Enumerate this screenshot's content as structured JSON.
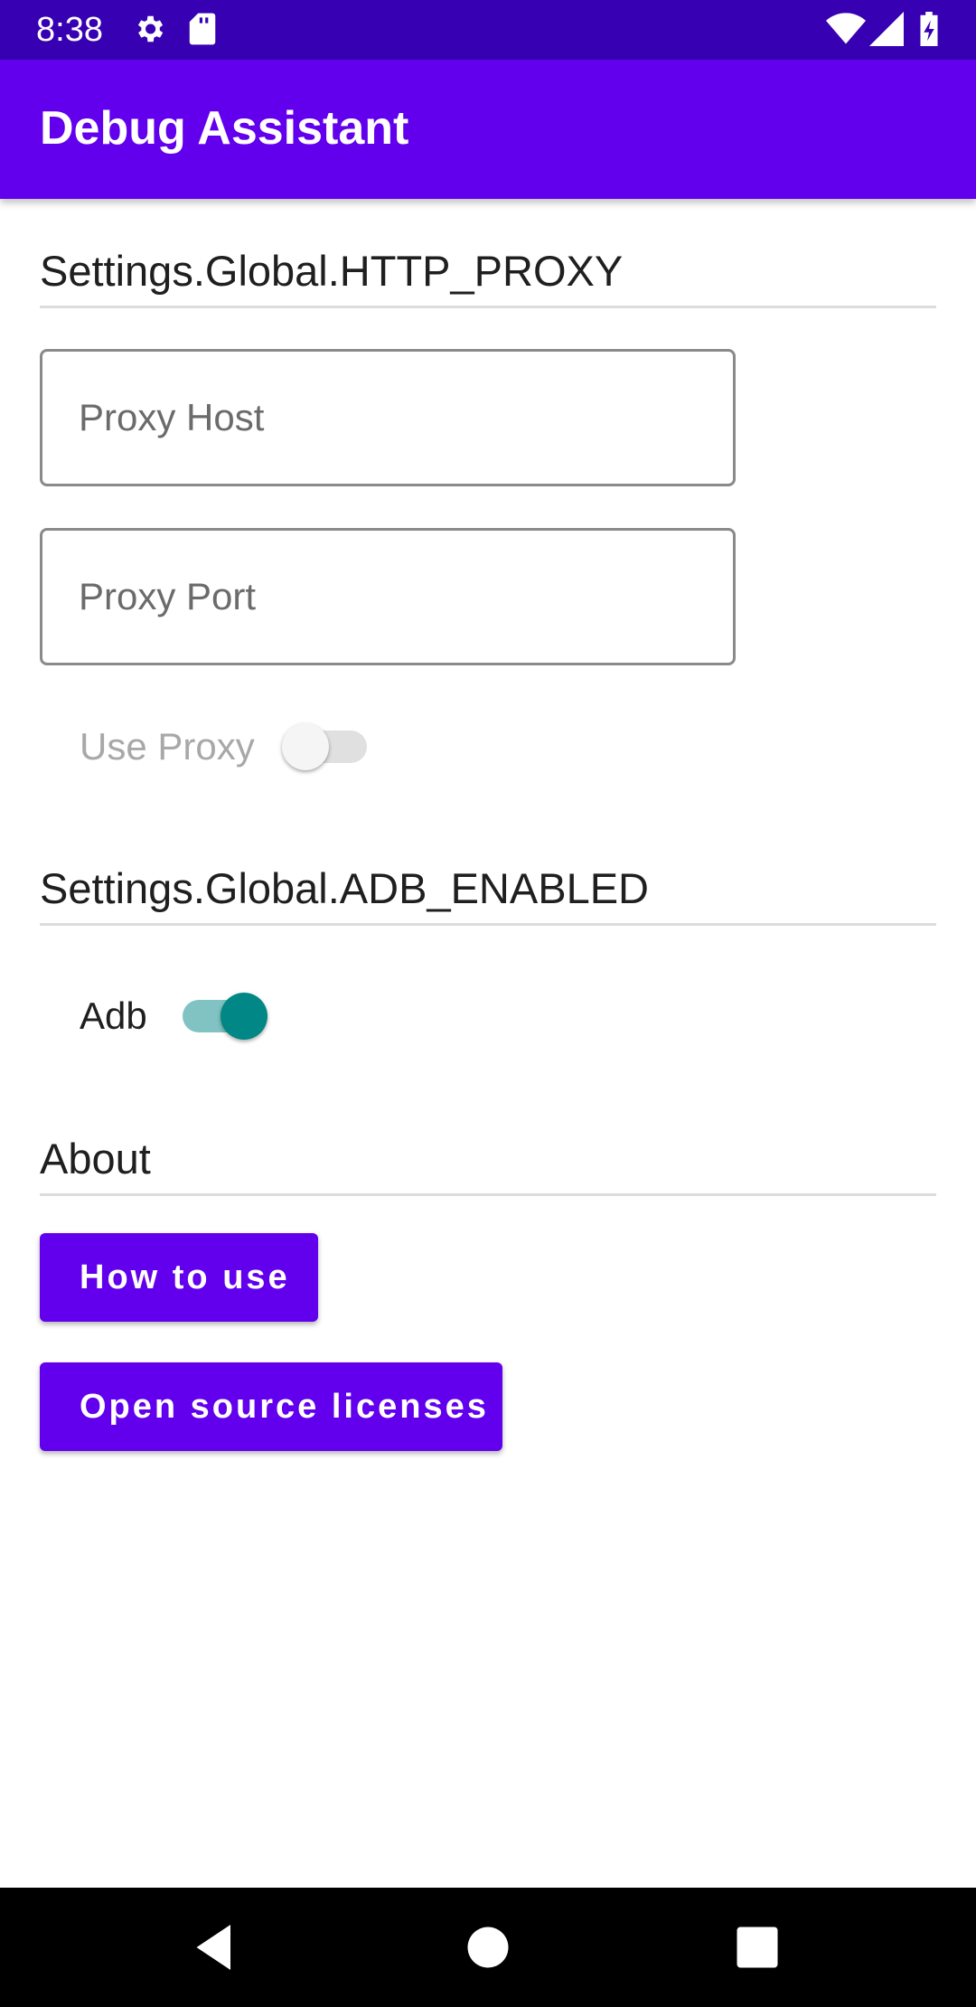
{
  "status_bar": {
    "time": "8:38",
    "icons": [
      "gear-icon",
      "sd-card-icon",
      "wifi-icon",
      "cell-signal-icon",
      "battery-charging-icon"
    ]
  },
  "app_bar": {
    "title": "Debug Assistant",
    "color": "#6200ee"
  },
  "http_proxy": {
    "section_title": "Settings.Global.HTTP_PROXY",
    "host_field": {
      "value": "",
      "placeholder": "Proxy Host"
    },
    "port_field": {
      "value": "",
      "placeholder": "Proxy Port"
    },
    "use_proxy": {
      "label": "Use Proxy",
      "enabled": false,
      "checked": false
    }
  },
  "adb": {
    "section_title": "Settings.Global.ADB_ENABLED",
    "toggle": {
      "label": "Adb",
      "enabled": true,
      "checked": true,
      "accent": "#018786"
    }
  },
  "about": {
    "section_title": "About",
    "how_to_use_label": "How to use",
    "licenses_label": "Open source licenses"
  },
  "nav_bar": {
    "icons": [
      "back-icon",
      "home-icon",
      "recents-icon"
    ]
  }
}
